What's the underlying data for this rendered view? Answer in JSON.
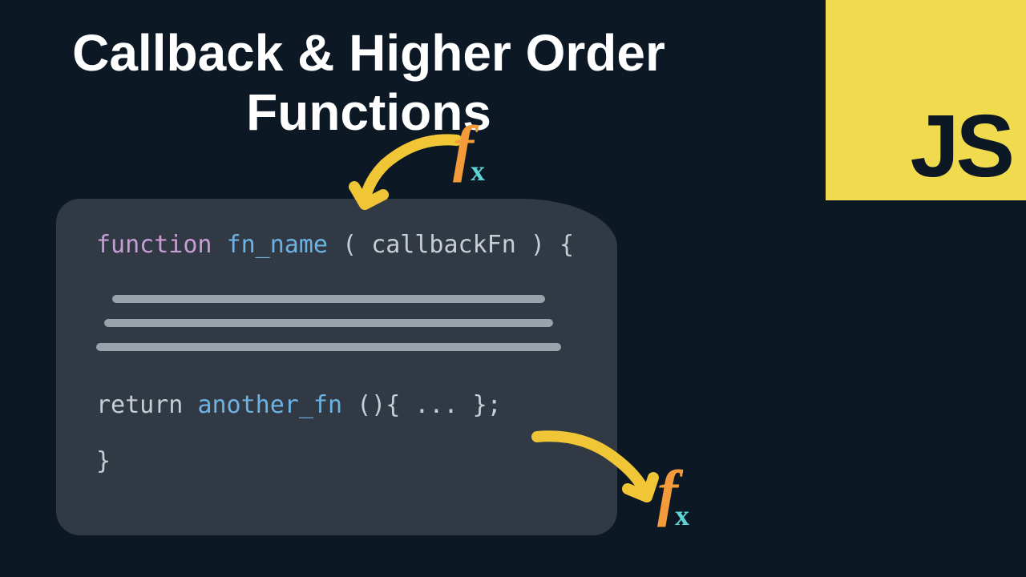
{
  "title": "Callback & Higher Order Functions",
  "jsLogo": "JS",
  "code": {
    "keyword_function": "function",
    "fn_name": "fn_name",
    "param": "callbackFn",
    "open_paren": "(",
    "close_paren": ")",
    "open_brace": " {",
    "keyword_return": " return ",
    "another_fn": "another_fn",
    "call_suffix": "(){ ... };",
    "close_brace": " }"
  },
  "fx_f": "f",
  "fx_x": "x"
}
